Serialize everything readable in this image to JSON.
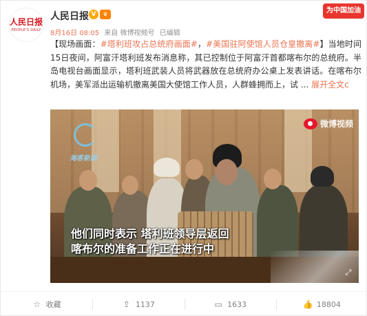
{
  "header": {
    "avatar_logo_cn": "人民日报",
    "avatar_logo_en": "PEOPLE'S DAILY",
    "user_name": "人民日报",
    "vip_badge": "V",
    "gold_badge": "♛",
    "time": "8月16日 08:05",
    "source": "来自 微博视频号",
    "edited": "已编辑",
    "promo": "为中国加油"
  },
  "post": {
    "lead": "【现场画面：",
    "tag1": "#塔利班攻占总统府画面#",
    "sep": "，",
    "tag2": "#美国驻阿使馆人员仓皇撤离#",
    "body": "】当地时间15日夜间，阿富汗塔利班发布消息称，其已控制位于阿富汗首都喀布尔的总统府。半岛电视台画面显示，塔利班武装人员将武器放在总统府办公桌上发表讲话。在喀布尔机场，美军派出运输机撤离美国大使馆工作人员，人群蜂拥而上，试 ...",
    "expand": "展开全文",
    "expand_arrow": "c"
  },
  "media": {
    "watermark_left": "海客新闻",
    "watermark_right": "微博视频",
    "subtitle_line1": "他们同时表示 塔利班领导层返回",
    "subtitle_line2": "喀布尔的准备工作正在进行中",
    "control_icon": "fullscreen-icon"
  },
  "actions": [
    {
      "icon": "star-icon",
      "glyph": "☆",
      "label": "收藏"
    },
    {
      "icon": "share-icon",
      "glyph": "⇪",
      "label": "1137"
    },
    {
      "icon": "comment-icon",
      "glyph": "▭",
      "label": "1633"
    },
    {
      "icon": "like-icon",
      "glyph": "👍",
      "label": "18804"
    }
  ],
  "colors": {
    "accent": "#eb7350",
    "promo": "#e8362f",
    "logo": "#d71921"
  }
}
